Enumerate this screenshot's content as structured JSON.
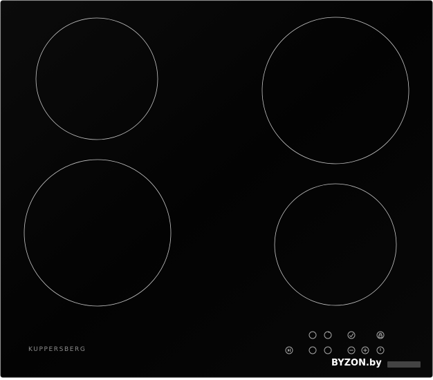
{
  "brand": {
    "name": "KUPPERSBERG"
  },
  "watermark": {
    "text": "BYZON.by"
  },
  "colors": {
    "glass": "#050505",
    "ring": "#c8c8c8",
    "control_glyph": "#a7a7a7"
  },
  "controls": {
    "top_row": [
      "circle-icon",
      "timer-icon",
      "check-icon",
      "lock-icon"
    ],
    "bottom_row": [
      "play-pause-icon",
      "circle-icon",
      "circle-icon",
      "minus-icon",
      "plus-icon",
      "power-icon"
    ]
  }
}
